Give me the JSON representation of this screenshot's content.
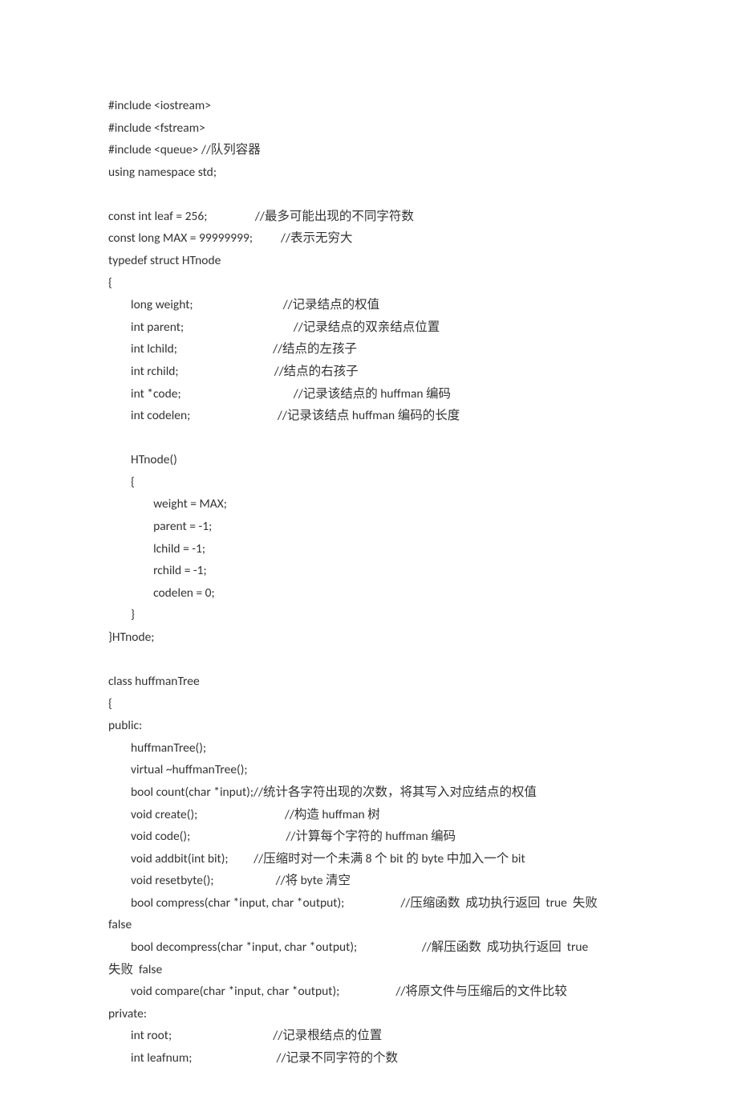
{
  "lines": [
    "#include <iostream>",
    "#include <fstream>",
    "#include <queue> //队列容器",
    "using namespace std;",
    "",
    "const int leaf = 256;                 //最多可能出现的不同字符数",
    "const long MAX = 99999999;          //表示无穷大",
    "typedef struct HTnode",
    "{",
    "        long weight;                                //记录结点的权值",
    "        int parent;                                       //记录结点的双亲结点位置",
    "        int lchild;                                  //结点的左孩子",
    "        int rchild;                                  //结点的右孩子",
    "        int *code;                                        //记录该结点的 huffman 编码",
    "        int codelen;                               //记录该结点 huffman 编码的长度",
    "",
    "        HTnode()",
    "        {",
    "                weight = MAX;",
    "                parent = -1;",
    "                lchild = -1;",
    "                rchild = -1;",
    "                codelen = 0;",
    "        }",
    "}HTnode;",
    "",
    "class huffmanTree",
    "{",
    "public:",
    "        huffmanTree();",
    "        virtual ~huffmanTree();",
    "        bool count(char *input);//统计各字符出现的次数，将其写入对应结点的权值",
    "        void create();                               //构造 huffman 树",
    "        void code();                                  //计算每个字符的 huffman 编码",
    "        void addbit(int bit);         //压缩时对一个未满 8 个 bit 的 byte 中加入一个 bit",
    "        void resetbyte();                      //将 byte 清空",
    "        bool compress(char *input, char *output);                    //压缩函数  成功执行返回  true  失败",
    "false",
    "        bool decompress(char *input, char *output);                       //解压函数  成功执行返回  true",
    "失败  false",
    "        void compare(char *input, char *output);                    //将原文件与压缩后的文件比较",
    "private:",
    "        int root;                                    //记录根结点的位置",
    "        int leafnum;                              //记录不同字符的个数"
  ]
}
